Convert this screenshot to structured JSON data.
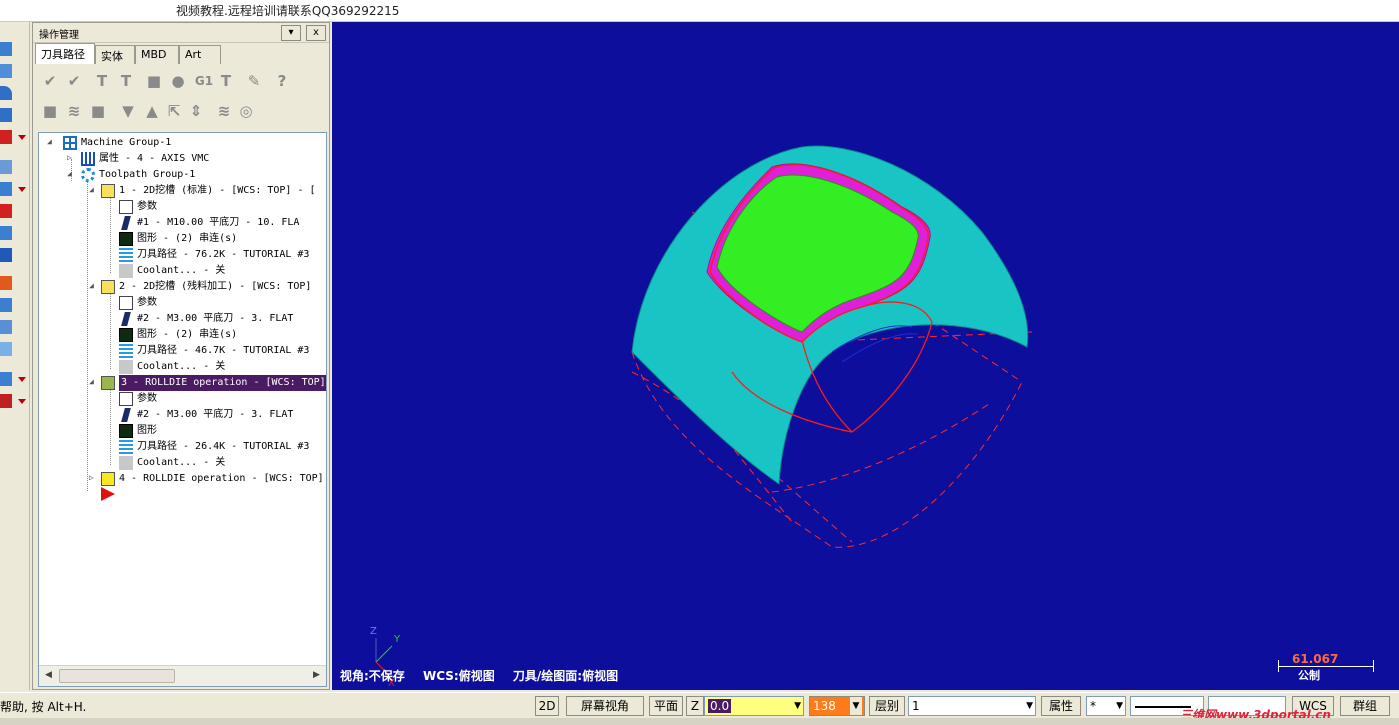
{
  "window": {
    "title": "视频教程.远程培训请联系QQ369292215"
  },
  "ops_panel": {
    "title": "操作管理",
    "dropdown_btn": "▾",
    "close_btn": "x",
    "tabs": [
      "刀具路径",
      "实体",
      "MBD",
      "Art"
    ],
    "active_tab": "刀具路径",
    "toolbar1_icons": [
      "select-all-icon",
      "select-failed-icon",
      "regenerate-selected-icon",
      "regenerate-dirty-icon",
      "backplot-icon",
      "verify-icon",
      "post-g1-icon",
      "high-feed-icon",
      "lock-tool-icon",
      "help-icon"
    ],
    "toolbar1_glyphs": [
      "✔",
      "✔",
      "T",
      "T",
      "■",
      "●",
      "G1",
      "T",
      "✎",
      "?"
    ],
    "toolbar2_icons": [
      "lock-icon",
      "toolpath-display-icon",
      "post-lock-icon",
      "move-down-icon",
      "move-up-icon",
      "insert-arrow-icon",
      "scroll-icon",
      "toggle-display-icon",
      "gouge-icon"
    ],
    "toolbar2_glyphs": [
      "■",
      "≋",
      "■",
      "▼",
      "▲",
      "⇱",
      "⇕",
      "≋",
      "◎"
    ]
  },
  "tree": {
    "machine_group": "Machine Group-1",
    "properties": "属性 - 4 - AXIS VMC",
    "toolpath_group": "Toolpath Group-1",
    "ops": [
      {
        "label": "1 - 2D挖槽 (标准) - [WCS: TOP] - [",
        "params": "参数",
        "tool": "#1 - M10.00 平底刀 -    10. FLA",
        "geometry": "图形 - (2) 串连(s)",
        "toolpath": "刀具路径 - 76.2K - TUTORIAL #3",
        "coolant": "Coolant... - 关"
      },
      {
        "label": "2 - 2D挖槽 (残料加工) - [WCS: TOP]",
        "params": "参数",
        "tool": "#2 - M3.00 平底刀 -    3. FLAT",
        "geometry": "图形 - (2) 串连(s)",
        "toolpath": "刀具路径 - 46.7K - TUTORIAL #3",
        "coolant": "Coolant... - 关"
      },
      {
        "label": "3 - ROLLDIE operation - [WCS: TOP]",
        "params": "参数",
        "tool": "#2 - M3.00 平底刀 -    3. FLAT",
        "geometry": "图形",
        "toolpath": "刀具路径 - 26.4K - TUTORIAL #3",
        "coolant": "Coolant... - 关"
      }
    ],
    "op4": "4 - ROLLDIE operation - [WCS: TOP]"
  },
  "viewport": {
    "view_info": [
      "视角:不保存",
      "WCS:俯视图",
      "刀具/绘图面:俯视图"
    ],
    "scale_value": "61.067",
    "scale_unit": "公制",
    "axis_labels": {
      "x": "X",
      "y": "Y",
      "z": "Z"
    },
    "colors": {
      "background": "#0d0e9c",
      "surface": "#19c4c4",
      "pocket": "#33ee22",
      "wall": "#e020d8",
      "toolpath": "#ff2a2a"
    }
  },
  "statusbar": {
    "help": "帮助, 按 Alt+H.",
    "btn_2d": "2D",
    "btn_screen_view": "屏幕视角",
    "btn_plane": "平面",
    "z_label": "Z",
    "z_value": "0.0",
    "color_value": "138",
    "level_label": "层别",
    "level_value": "1",
    "attr_label": "属性",
    "point_style": "*",
    "wcs_label": "WCS",
    "group_label": "群组",
    "watermark": "三维网www.3dportal.cn"
  }
}
